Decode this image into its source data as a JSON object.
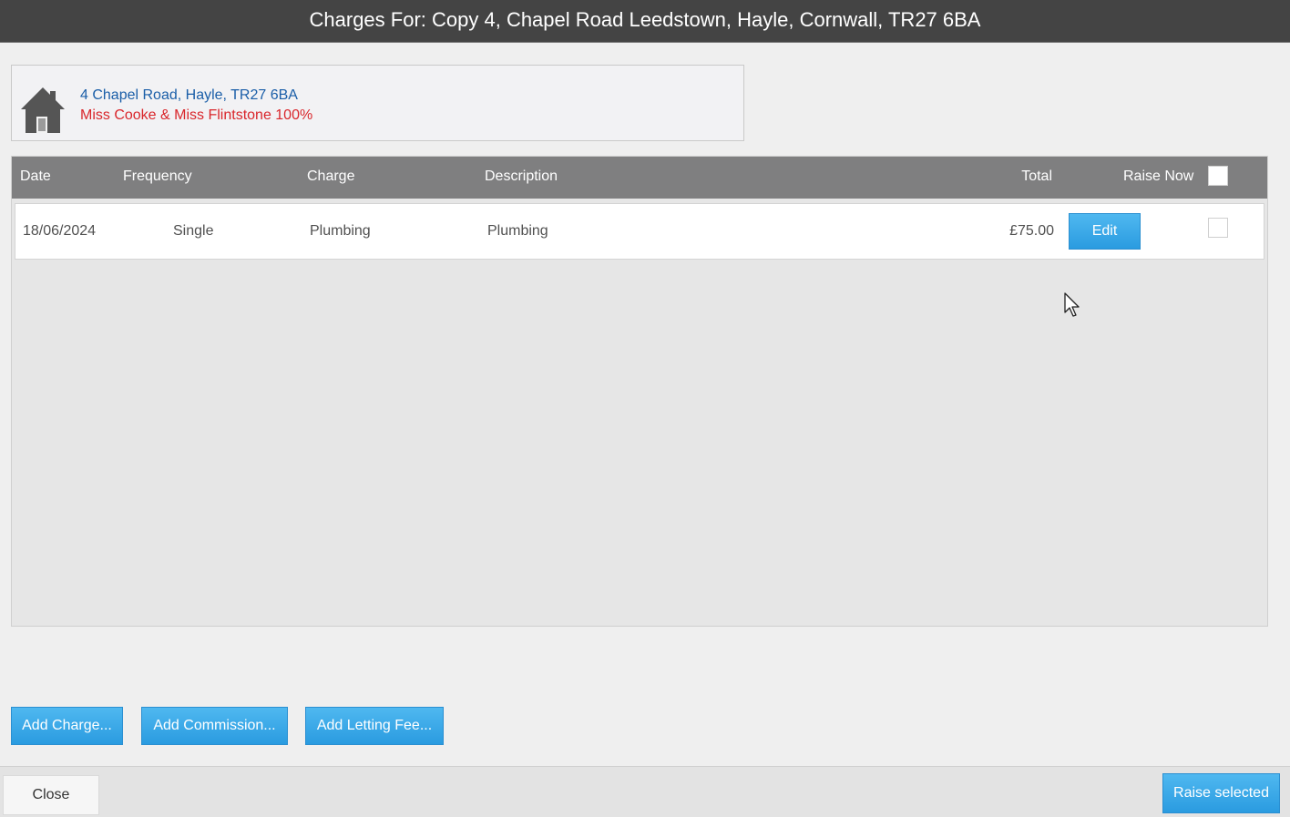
{
  "window": {
    "title": "Charges For: Copy 4, Chapel Road Leedstown, Hayle, Cornwall, TR27 6BA"
  },
  "property": {
    "address": "4 Chapel Road, Hayle, TR27 6BA",
    "owners": "Miss Cooke & Miss Flintstone 100%",
    "icon": "house-icon"
  },
  "grid": {
    "columns": {
      "date": "Date",
      "frequency": "Frequency",
      "charge": "Charge",
      "description": "Description",
      "total": "Total",
      "raise_now": "Raise Now"
    },
    "rows": [
      {
        "date": "18/06/2024",
        "frequency": "Single",
        "charge": "Plumbing",
        "description": "Plumbing",
        "total": "£75.00",
        "edit_label": "Edit",
        "raise_now": false
      }
    ]
  },
  "actions": {
    "add_charge": "Add Charge...",
    "add_commission": "Add Commission...",
    "add_letting_fee": "Add Letting Fee..."
  },
  "footer": {
    "close": "Close",
    "raise_selected": "Raise selected"
  },
  "colors": {
    "titlebar": "#444444",
    "accent_blue": "#2a9be0",
    "address_blue": "#1a5ea8",
    "owner_red": "#d9262b",
    "grid_header": "#7f7f80"
  }
}
